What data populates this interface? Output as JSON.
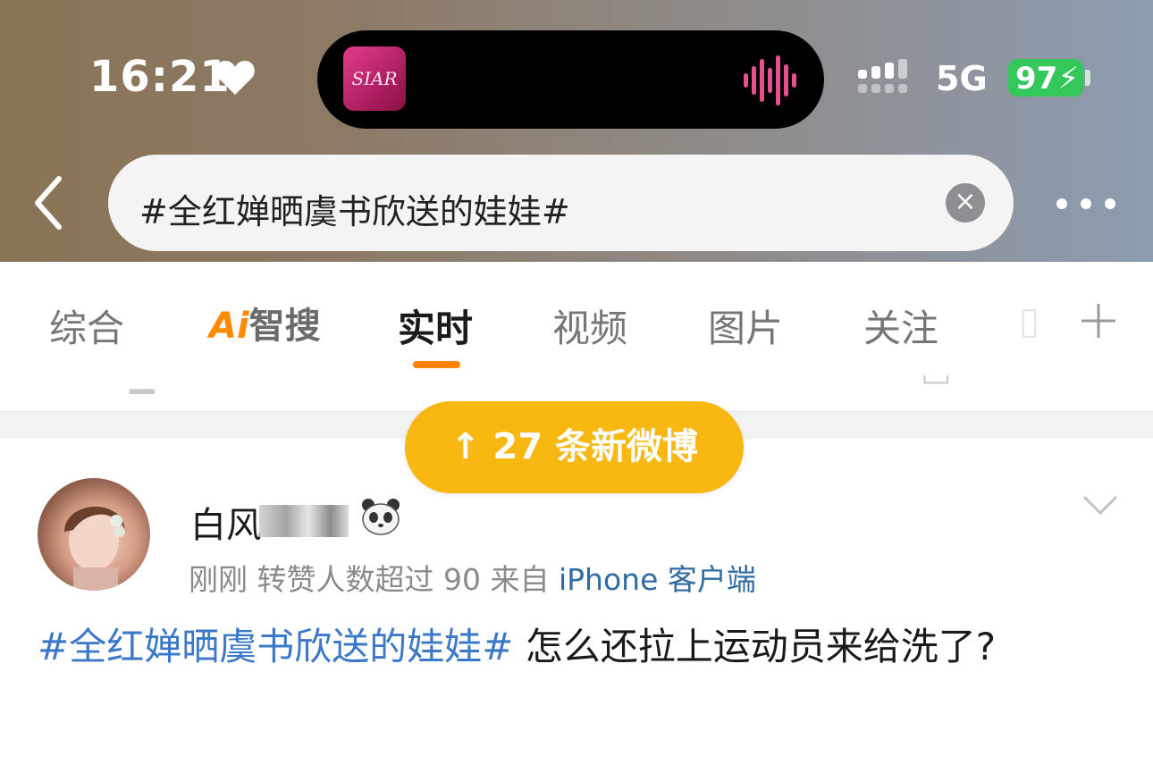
{
  "status_bar": {
    "time": "16:21",
    "network": "5G",
    "battery": "97",
    "album_art_text": "SIAR"
  },
  "search": {
    "query": "#全红婵晒虞书欣送的娃娃#"
  },
  "tabs": [
    {
      "label": "综合",
      "active": false
    },
    {
      "label": "Ai智搜",
      "active": false
    },
    {
      "label": "实时",
      "active": true
    },
    {
      "label": "视频",
      "active": false
    },
    {
      "label": "图片",
      "active": false
    },
    {
      "label": "关注",
      "active": false
    }
  ],
  "ai_tab": {
    "prefix": "Ai",
    "rest": "智搜"
  },
  "new_posts_button": "↑ 27 条新微博",
  "post": {
    "username": "白风",
    "time": "刚刚",
    "reposts_note": "转赞人数超过 90",
    "source_prefix": "来自",
    "source": "iPhone 客户端",
    "hashtag": "#全红婵晒虞书欣送的娃娃#",
    "text": " 怎么还拉上运动员来给洗了?"
  },
  "colors": {
    "accent_orange": "#ff8200",
    "pill_yellow": "#f8b711",
    "link_blue": "#3c78c8",
    "battery_green": "#34c759"
  },
  "icons": [
    "heart-icon",
    "waveform-icon",
    "signal-icon",
    "back-icon",
    "clear-icon",
    "more-icon",
    "add-tab-icon",
    "panda-icon",
    "chevron-down-icon"
  ]
}
